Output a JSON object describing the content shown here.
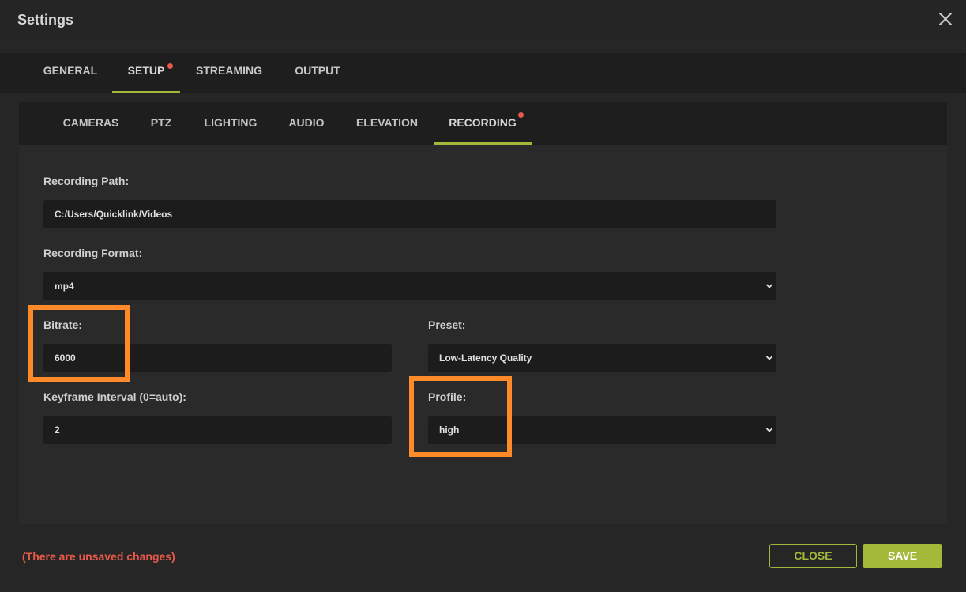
{
  "window": {
    "title": "Settings",
    "close_icon": "close-icon"
  },
  "top_tabs": [
    {
      "label": "GENERAL",
      "active": false,
      "dot": false
    },
    {
      "label": "SETUP",
      "active": true,
      "dot": true
    },
    {
      "label": "STREAMING",
      "active": false,
      "dot": false
    },
    {
      "label": "OUTPUT",
      "active": false,
      "dot": false
    }
  ],
  "sub_tabs": [
    {
      "label": "CAMERAS",
      "active": false,
      "dot": false
    },
    {
      "label": "PTZ",
      "active": false,
      "dot": false
    },
    {
      "label": "LIGHTING",
      "active": false,
      "dot": false
    },
    {
      "label": "AUDIO",
      "active": false,
      "dot": false
    },
    {
      "label": "ELEVATION",
      "active": false,
      "dot": false
    },
    {
      "label": "RECORDING",
      "active": true,
      "dot": true
    }
  ],
  "form": {
    "recording_path": {
      "label": "Recording Path:",
      "value": "C:/Users/Quicklink/Videos"
    },
    "recording_format": {
      "label": "Recording Format:",
      "value": "mp4"
    },
    "bitrate": {
      "label": "Bitrate:",
      "value": "6000"
    },
    "preset": {
      "label": "Preset:",
      "value": "Low-Latency Quality"
    },
    "keyframe_interval": {
      "label": "Keyframe Interval (0=auto):",
      "value": "2"
    },
    "profile": {
      "label": "Profile:",
      "value": "high"
    }
  },
  "footer": {
    "unsaved_text": "(There are unsaved changes)",
    "close_label": "CLOSE",
    "save_label": "SAVE"
  },
  "colors": {
    "accent": "#a4b83a",
    "warning": "#e85a4a",
    "highlight": "#ff8a2a"
  }
}
